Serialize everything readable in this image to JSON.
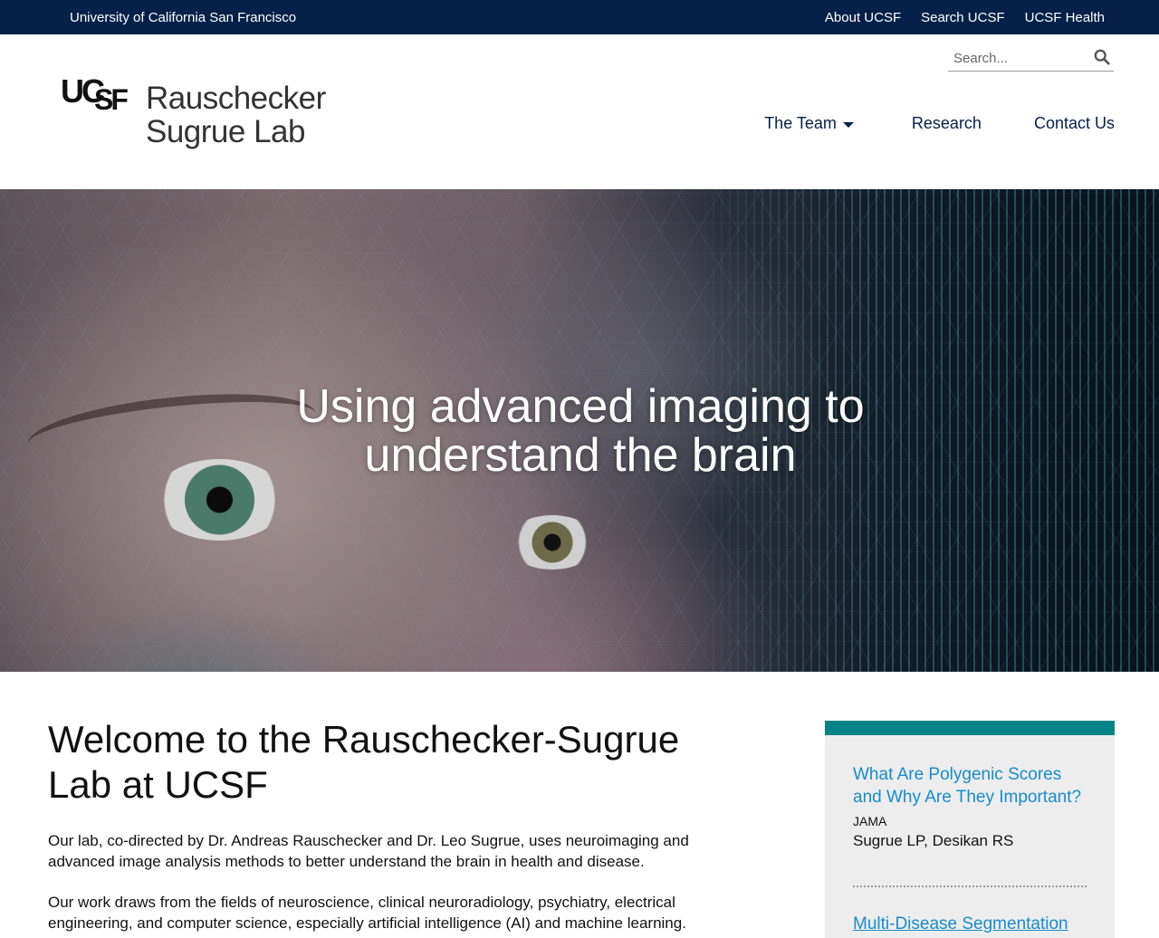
{
  "utility": {
    "university": "University of California San Francisco",
    "links": [
      "About UCSF",
      "Search UCSF",
      "UCSF Health"
    ]
  },
  "header": {
    "logo_mark": "UCSF",
    "lab_name_line1": "Rauschecker",
    "lab_name_line2": "Sugrue Lab",
    "search_placeholder": "Search..."
  },
  "nav": {
    "items": [
      {
        "label": "The Team",
        "has_dropdown": true
      },
      {
        "label": "Research"
      },
      {
        "label": "Contact Us"
      }
    ]
  },
  "hero": {
    "headline_line1": "Using advanced imaging to",
    "headline_line2": "understand the brain"
  },
  "main": {
    "heading_line1": "Welcome to the Rauschecker-Sugrue",
    "heading_line2": "Lab at UCSF",
    "paragraph1": "Our lab, co-directed by Dr. Andreas Rauschecker and Dr. Leo Sugrue, uses neuroimaging and advanced image analysis methods to better understand the brain in health and disease.",
    "paragraph2": "Our work draws from the fields of neuroscience, clinical neuroradiology, psychiatry, electrical engineering, and computer science, especially artificial intelligence (AI) and machine learning."
  },
  "sidebar": {
    "accent_color": "#058488",
    "publications": [
      {
        "title": "What Are Polygenic Scores and Why Are They Important?",
        "journal": "JAMA",
        "authors": "Sugrue LP, Desikan RS"
      },
      {
        "title": "Multi-Disease Segmentation",
        "journal": "",
        "authors": ""
      }
    ]
  },
  "colors": {
    "utility_bg": "#052049",
    "nav_text": "#052049",
    "link_blue": "#178ccb",
    "teal": "#058488"
  },
  "icons": {
    "search": "magnifier-icon",
    "dropdown": "caret-down-icon"
  }
}
